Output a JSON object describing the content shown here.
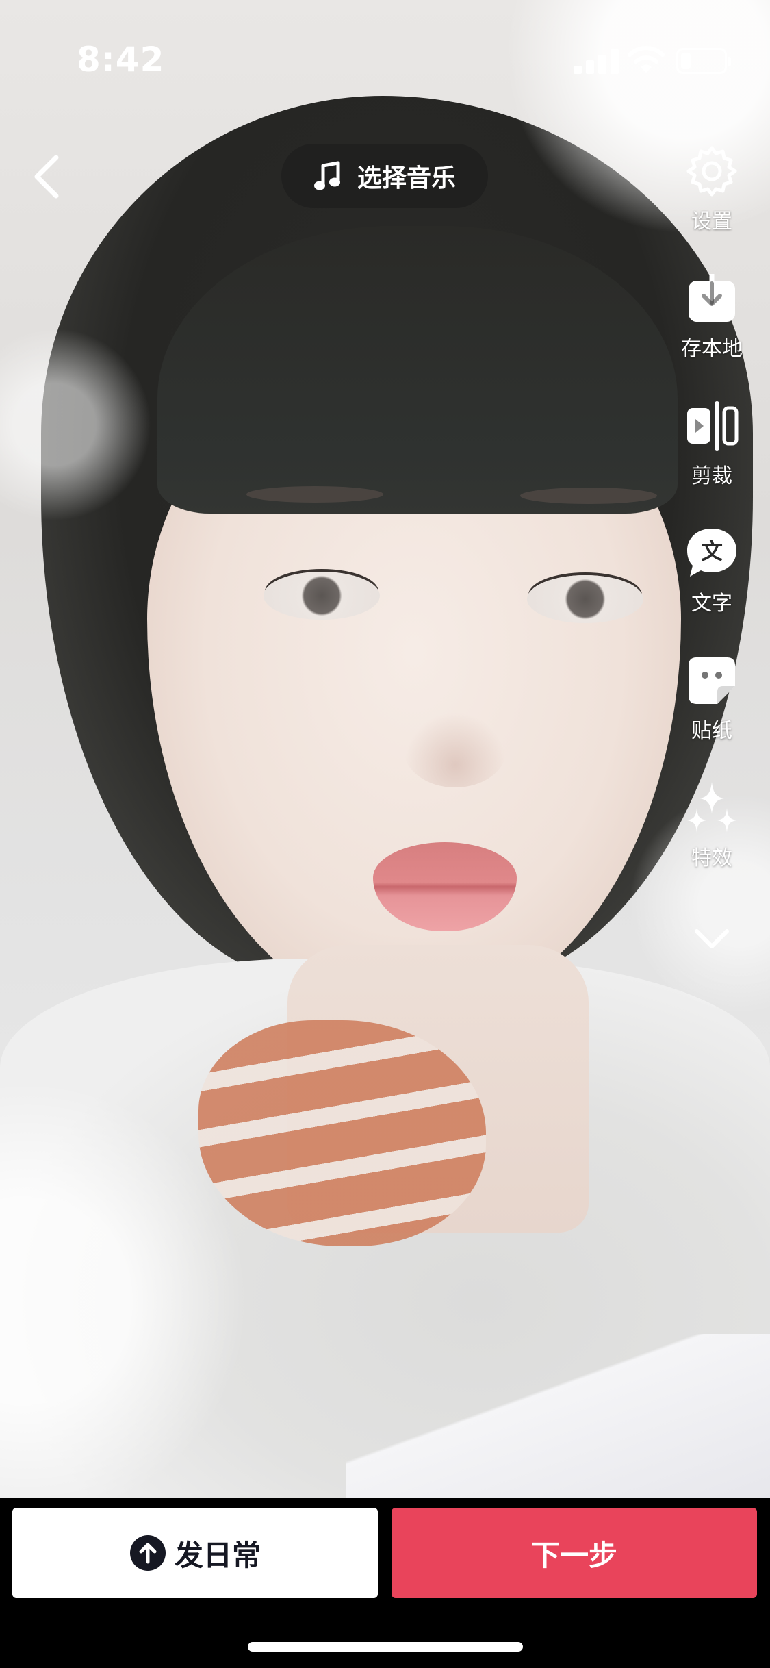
{
  "status_bar": {
    "time": "8:42"
  },
  "top": {
    "back_icon": "chevron-left-icon",
    "music_label": "选择音乐",
    "music_icon": "music-note-icon"
  },
  "tools": [
    {
      "id": "settings",
      "label": "设置",
      "icon": "gear-icon"
    },
    {
      "id": "save-local",
      "label": "存本地",
      "icon": "download-icon"
    },
    {
      "id": "trim",
      "label": "剪裁",
      "icon": "trim-icon"
    },
    {
      "id": "text",
      "label": "文字",
      "icon": "text-bubble-icon"
    },
    {
      "id": "sticker",
      "label": "贴纸",
      "icon": "sticker-icon"
    },
    {
      "id": "effects",
      "label": "特效",
      "icon": "sparkle-icon"
    }
  ],
  "text_icon_glyph": "文",
  "more_icon": "chevron-down-icon",
  "bottom": {
    "daily_label": "发日常",
    "next_label": "下一步"
  },
  "colors": {
    "accent": "#e9445b",
    "pill_bg": "#1e1e1e",
    "dark_text": "#161823"
  }
}
